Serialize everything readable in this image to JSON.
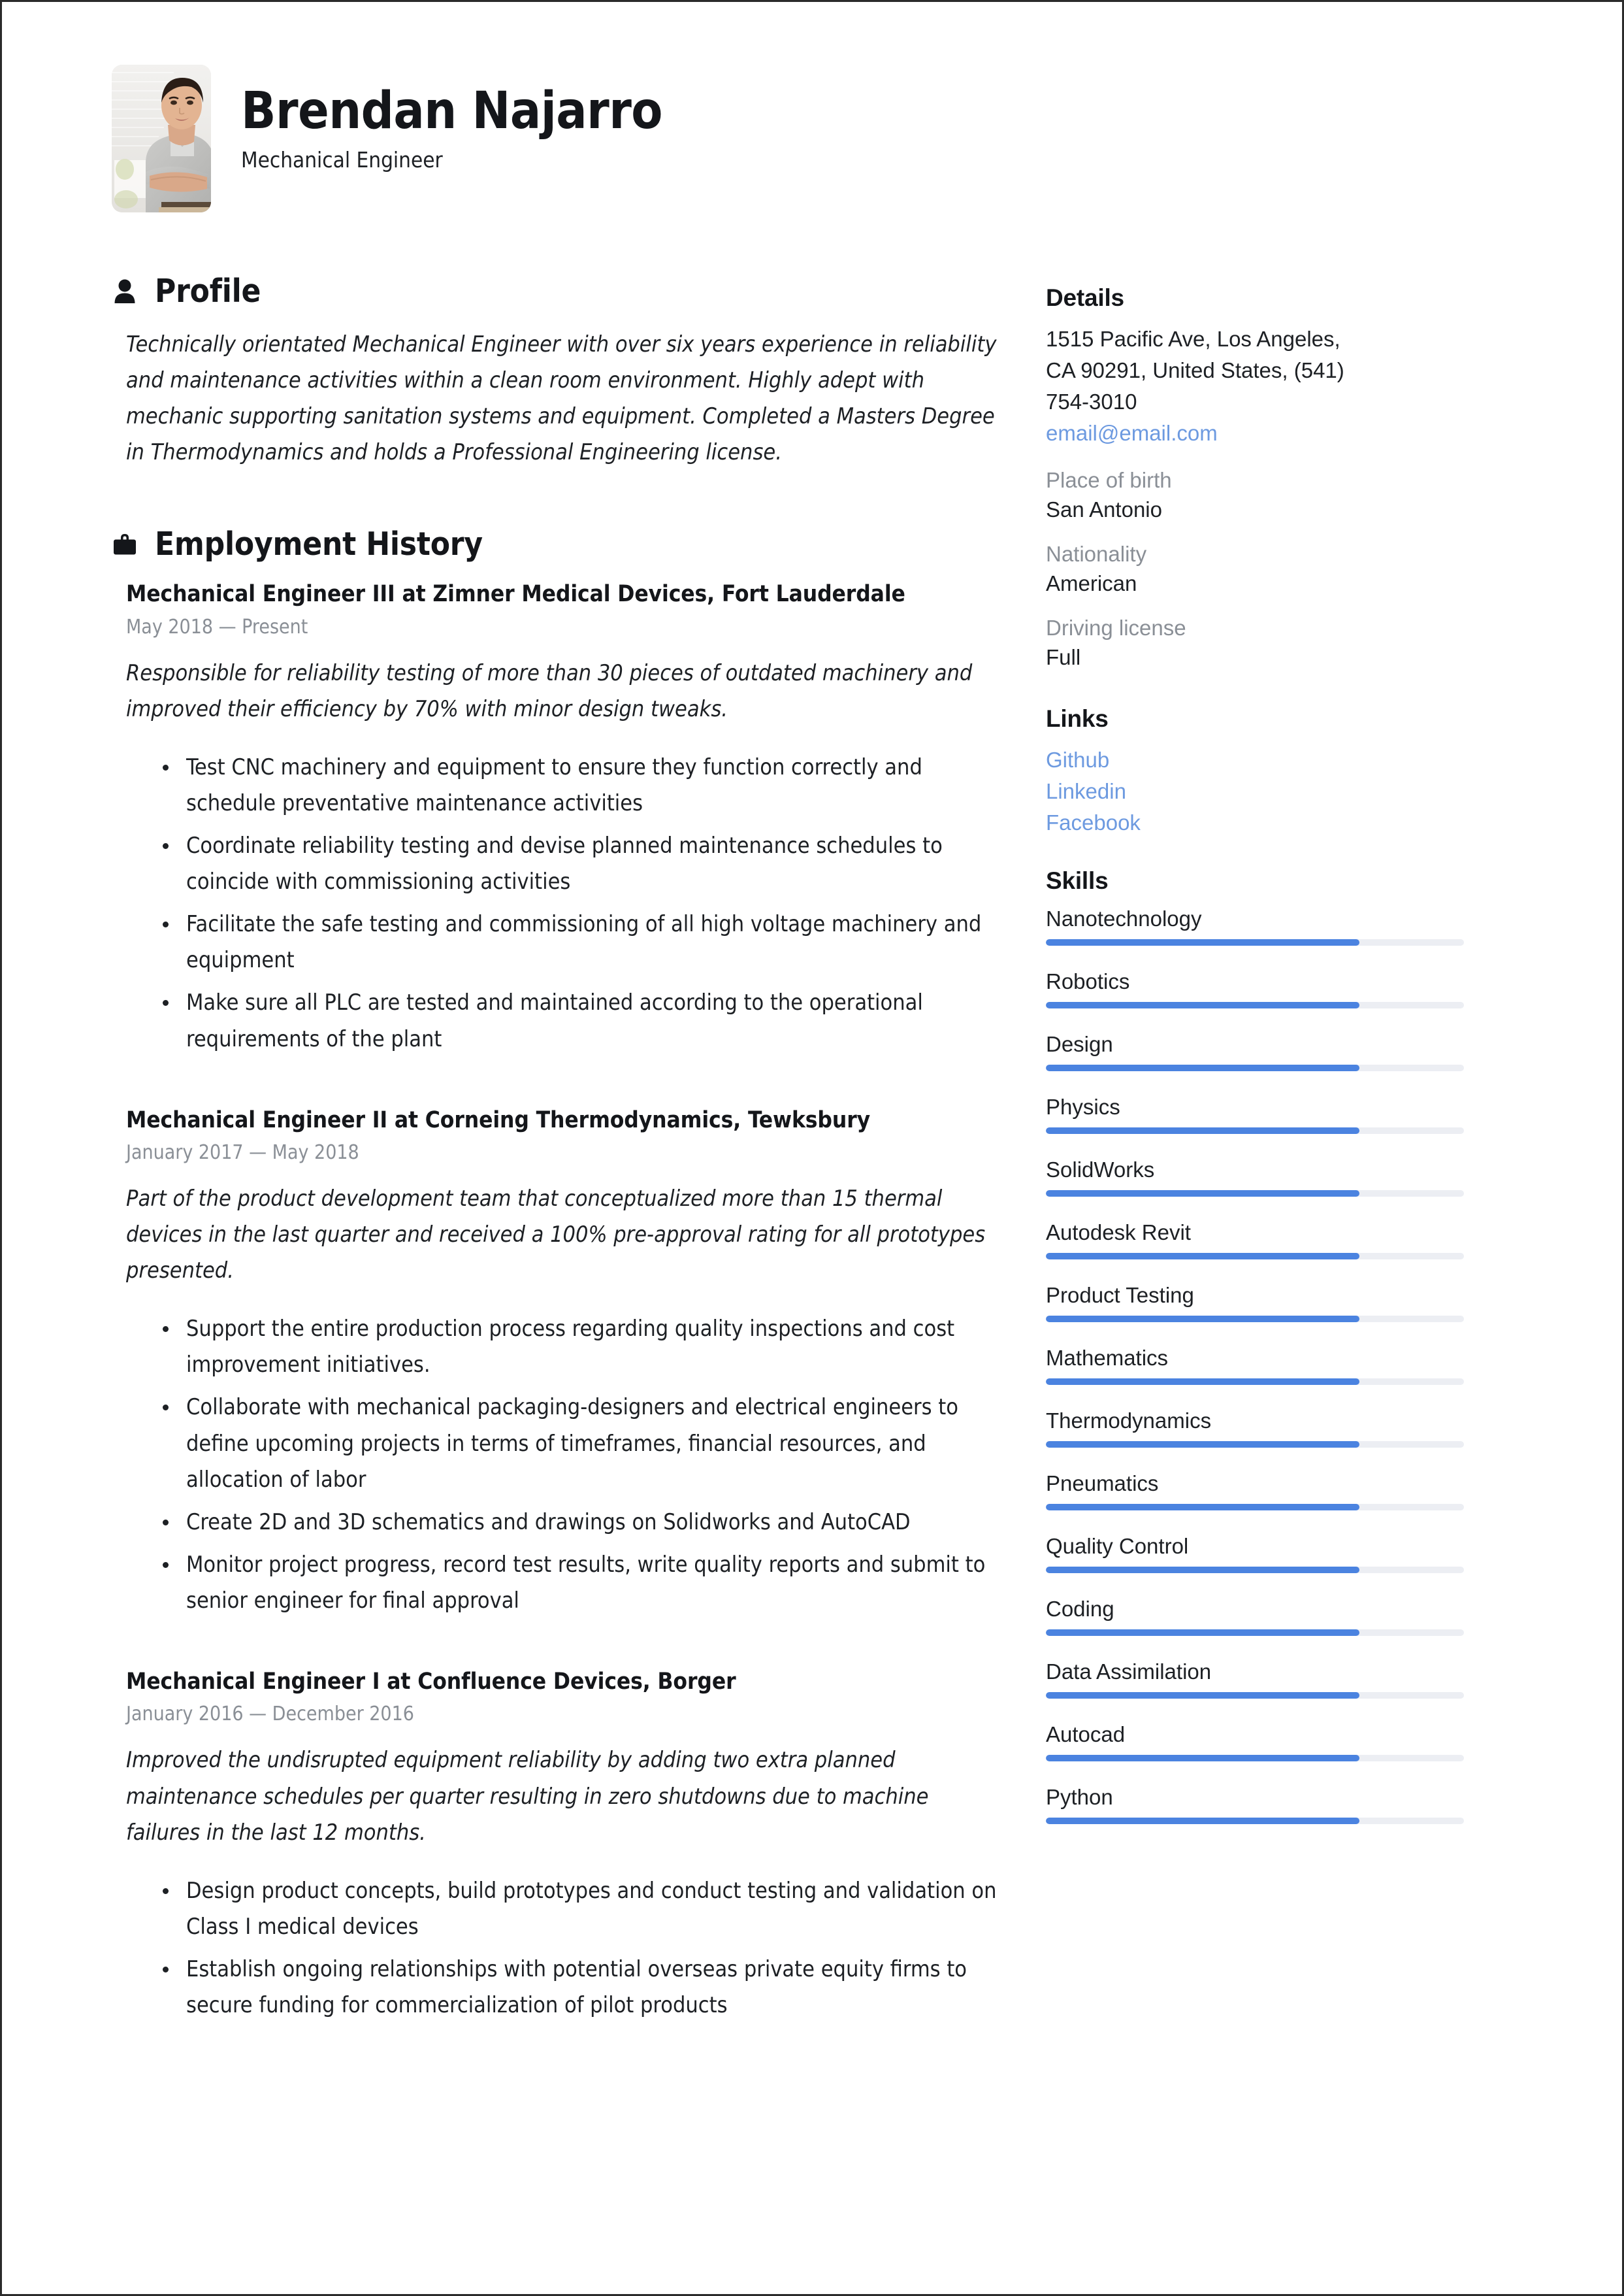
{
  "header": {
    "name": "Brendan Najarro",
    "job_title": "Mechanical Engineer",
    "photo_alt": "portrait-photo"
  },
  "profile": {
    "heading": "Profile",
    "icon": "person-icon",
    "summary": " Technically orientated Mechanical Engineer with over six years experience in reliability and maintenance activities within a clean room environment. Highly adept with mechanic supporting sanitation systems and equipment. Completed a Masters Degree in Thermodynamics and holds a Professional Engineering license."
  },
  "employment": {
    "heading": "Employment History",
    "icon": "briefcase-icon",
    "jobs": [
      {
        "title": "Mechanical Engineer III  at  Zimner Medical Devices, Fort Lauderdale",
        "dates": "May 2018 — Present",
        "description": "Responsible for reliability testing of more than 30 pieces of outdated machinery and improved their efficiency by 70% with minor design tweaks.",
        "bullets": [
          "Test CNC machinery and equipment to ensure they function correctly and schedule preventative maintenance activities",
          "Coordinate reliability testing and devise planned maintenance schedules to coincide with commissioning activities",
          "Facilitate the safe testing and commissioning of all high voltage machinery and equipment",
          "Make sure all PLC are tested and maintained according to the operational requirements of the plant"
        ]
      },
      {
        "title": "Mechanical Engineer II at  Corneing Thermodynamics, Tewksbury",
        "dates": "January 2017 — May 2018",
        "description": "Part of the product development team that conceptualized more than 15 thermal devices in the last quarter and received a 100% pre-approval rating for all prototypes presented.",
        "bullets": [
          "Support the entire production process regarding quality inspections and cost improvement initiatives.",
          "Collaborate with mechanical packaging-designers and electrical engineers to define upcoming projects in terms of timeframes, financial resources, and allocation of labor",
          "Create 2D and 3D schematics and drawings on Solidworks and AutoCAD",
          "Monitor project progress, record test results, write quality reports and submit to senior engineer for final approval"
        ]
      },
      {
        "title": "Mechanical Engineer I at  Confluence Devices, Borger",
        "dates": "January 2016 — December 2016",
        "description": "Improved the undisrupted equipment reliability by adding two extra planned maintenance schedules per quarter resulting in zero shutdowns due to machine failures in the last 12 months.",
        "bullets": [
          "Design product concepts, build prototypes and conduct testing and validation on Class I medical devices",
          "Establish ongoing relationships with potential overseas private equity firms to secure funding for commercialization of pilot products"
        ]
      }
    ]
  },
  "details": {
    "heading": "Details",
    "address_line_1": "1515 Pacific Ave, Los Angeles,",
    "address_line_2": "CA 90291, United States, (541)",
    "address_line_3": "754-3010",
    "email": "email@email.com",
    "place_of_birth_label": "Place of birth",
    "place_of_birth_value": "San Antonio",
    "nationality_label": "Nationality",
    "nationality_value": "American",
    "driving_license_label": "Driving license",
    "driving_license_value": "Full"
  },
  "links": {
    "heading": "Links",
    "items": [
      {
        "label": "Github"
      },
      {
        "label": "Linkedin"
      },
      {
        "label": "Facebook"
      }
    ]
  },
  "skills": {
    "heading": "Skills",
    "items": [
      {
        "name": "Nanotechnology",
        "level": 75
      },
      {
        "name": "Robotics",
        "level": 75
      },
      {
        "name": "Design",
        "level": 75
      },
      {
        "name": "Physics",
        "level": 75
      },
      {
        "name": "SolidWorks",
        "level": 75
      },
      {
        "name": "Autodesk Revit",
        "level": 75
      },
      {
        "name": "Product Testing",
        "level": 75
      },
      {
        "name": "Mathematics",
        "level": 75
      },
      {
        "name": "Thermodynamics",
        "level": 75
      },
      {
        "name": "Pneumatics",
        "level": 75
      },
      {
        "name": "Quality Control",
        "level": 75
      },
      {
        "name": "Coding",
        "level": 75
      },
      {
        "name": "Data Assimilation",
        "level": 75
      },
      {
        "name": "Autocad",
        "level": 75
      },
      {
        "name": "Python",
        "level": 75
      }
    ]
  },
  "colors": {
    "accent_blue": "#4b83e0",
    "link_blue": "#6d9ae0",
    "track_gray": "#eceef3",
    "muted_text": "#8a8f96",
    "body_text": "#1d2024"
  }
}
